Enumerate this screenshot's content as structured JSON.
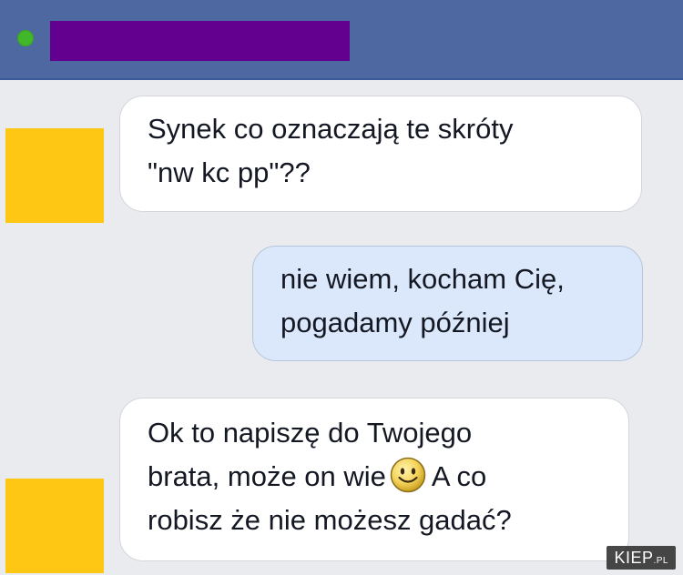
{
  "chat": {
    "messages": [
      {
        "direction": "incoming",
        "lines": [
          "Synek co oznaczają te skróty",
          "\"nw kc pp\"??"
        ]
      },
      {
        "direction": "outgoing",
        "lines": [
          "nie wiem, kocham Cię,",
          "pogadamy później"
        ]
      },
      {
        "direction": "incoming",
        "lines": [
          "Ok to napiszę do Twojego",
          "brata, może on wie",
          "A co",
          "robisz że nie możesz gadać?"
        ]
      }
    ]
  },
  "colors": {
    "header": "#4e69a2",
    "online_status": "#42b72a",
    "name_redaction": "#64008f",
    "avatar_redaction": "#fdc713",
    "incoming_bubble": "#ffffff",
    "outgoing_bubble": "#dbe8fb",
    "background": "#e9ebee"
  },
  "icons": {
    "status": "online-status-icon",
    "emoji": "smiley-emoji-icon"
  },
  "watermark": {
    "brand": "KIEP",
    "suffix": ".PL"
  }
}
